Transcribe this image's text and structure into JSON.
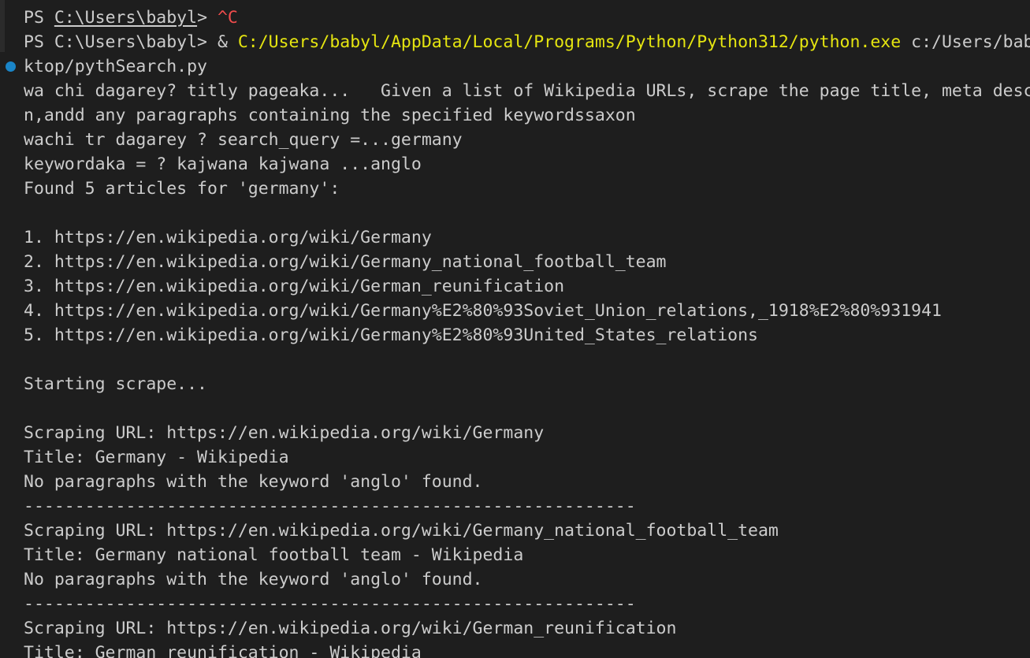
{
  "terminal": {
    "lines": {
      "l1": {
        "ps": "PS ",
        "path": "C:\\Users\\babyl",
        "gt": "> ",
        "ctrl": "^C"
      },
      "l2": {
        "prefix": "PS C:\\Users\\babyl> & ",
        "exe": "C:/Users/babyl/AppData/Local/Programs/Python/Python312/python.exe",
        "arg": " c:/Users/bab"
      },
      "l3": "ktop/pythSearch.py",
      "l4": "wa chi dagarey? titly pageaka...   Given a list of Wikipedia URLs, scrape the page title, meta desc",
      "l5": "n,andd any paragraphs containing the specified keywordssaxon",
      "l6": "wachi tr dagarey ? search_query =...germany",
      "l7": "keywordaka = ? kajwana kajwana ...anglo",
      "l8": "Found 5 articles for 'germany':",
      "l10": "1. https://en.wikipedia.org/wiki/Germany",
      "l11": "2. https://en.wikipedia.org/wiki/Germany_national_football_team",
      "l12": "3. https://en.wikipedia.org/wiki/German_reunification",
      "l13": "4. https://en.wikipedia.org/wiki/Germany%E2%80%93Soviet_Union_relations,_1918%E2%80%931941",
      "l14": "5. https://en.wikipedia.org/wiki/Germany%E2%80%93United_States_relations",
      "l16": "Starting scrape...",
      "l18": "Scraping URL: https://en.wikipedia.org/wiki/Germany",
      "l19": "Title: Germany - Wikipedia",
      "l20": "No paragraphs with the keyword 'anglo' found.",
      "l21": "------------------------------------------------------------",
      "l22": "Scraping URL: https://en.wikipedia.org/wiki/Germany_national_football_team",
      "l23": "Title: Germany national football team - Wikipedia",
      "l24": "No paragraphs with the keyword 'anglo' found.",
      "l25": "------------------------------------------------------------",
      "l26": "Scraping URL: https://en.wikipedia.org/wiki/German_reunification",
      "l27": "Title: German reunification - Wikipedia"
    }
  },
  "colors": {
    "background": "#1e1e1e",
    "text": "#cccccc",
    "ctrl_c": "#f14c4c",
    "exe_path": "#e5e510",
    "marker": "#1a85c8"
  },
  "icons": {
    "marker": "command-decoration-circle-icon"
  }
}
